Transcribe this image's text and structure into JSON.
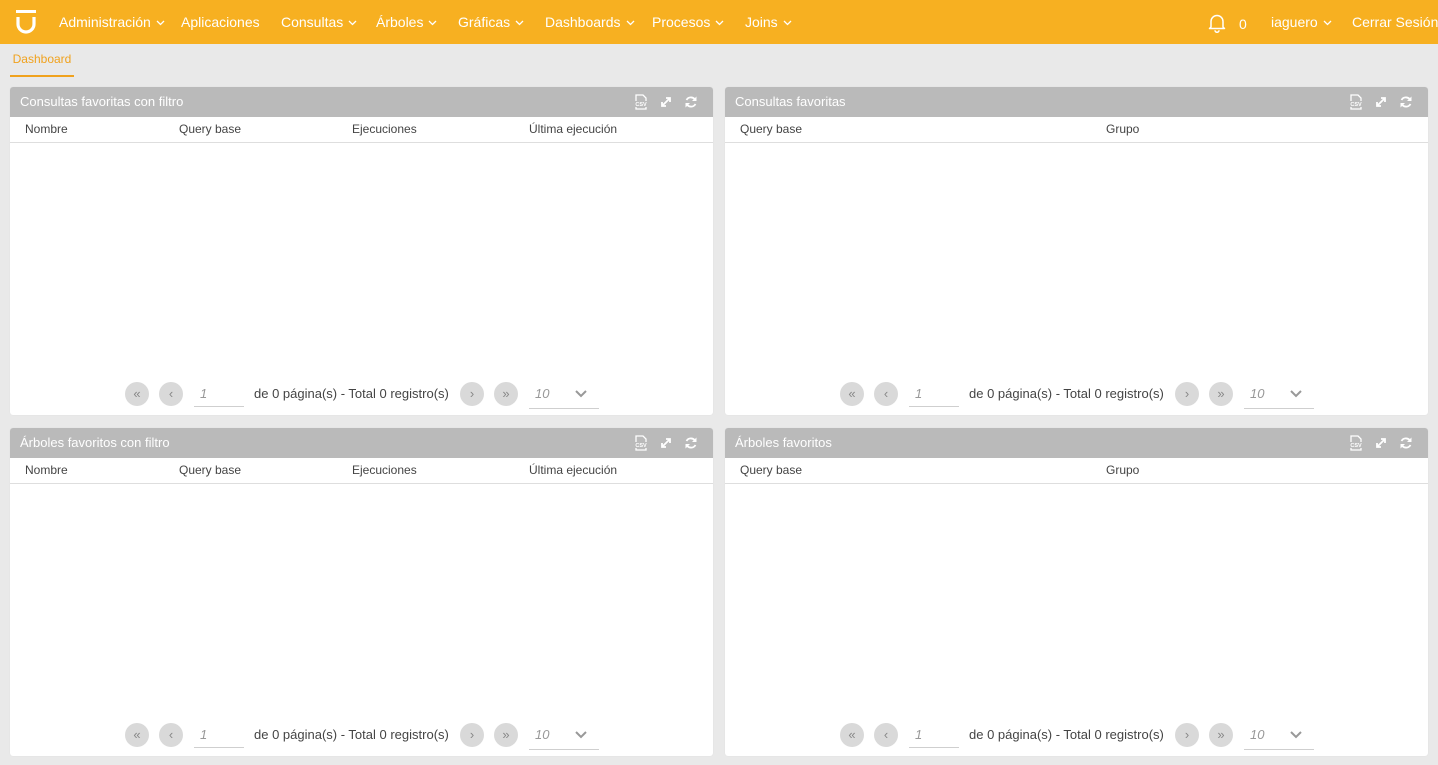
{
  "colors": {
    "accent": "#f7b021",
    "panel_header": "#bababa",
    "background": "#e9e9e9"
  },
  "navbar": {
    "items": [
      {
        "label": "Administración",
        "dropdown": true
      },
      {
        "label": "Aplicaciones",
        "dropdown": false
      },
      {
        "label": "Consultas",
        "dropdown": true
      },
      {
        "label": "Árboles",
        "dropdown": true
      },
      {
        "label": "Gráficas",
        "dropdown": true
      },
      {
        "label": "Dashboards",
        "dropdown": true
      },
      {
        "label": "Procesos",
        "dropdown": true
      },
      {
        "label": "Joins",
        "dropdown": true
      }
    ],
    "notifications_count": "0",
    "user": "iaguero",
    "logout": "Cerrar Sesión"
  },
  "tabs": [
    {
      "label": "Dashboard",
      "active": true
    }
  ],
  "panels": [
    {
      "title": "Consultas favoritas con filtro",
      "columns": [
        "Nombre",
        "Query base",
        "Ejecuciones",
        "Última ejecución"
      ],
      "rows": [],
      "pager": {
        "page": "1",
        "info": "de 0 página(s) - Total 0 registro(s)",
        "page_size": "10"
      }
    },
    {
      "title": "Consultas favoritas",
      "columns": [
        "Query base",
        "Grupo"
      ],
      "rows": [],
      "pager": {
        "page": "1",
        "info": "de 0 página(s) - Total 0 registro(s)",
        "page_size": "10"
      }
    },
    {
      "title": "Árboles favoritos con filtro",
      "columns": [
        "Nombre",
        "Query base",
        "Ejecuciones",
        "Última ejecución"
      ],
      "rows": [],
      "pager": {
        "page": "1",
        "info": "de 0 página(s) - Total 0 registro(s)",
        "page_size": "10"
      }
    },
    {
      "title": "Árboles favoritos",
      "columns": [
        "Query base",
        "Grupo"
      ],
      "rows": [],
      "pager": {
        "page": "1",
        "info": "de 0 página(s) - Total 0 registro(s)",
        "page_size": "10"
      }
    }
  ],
  "panel_icons": [
    "csv-export-icon",
    "expand-icon",
    "refresh-icon"
  ],
  "pager_icons": [
    "first-page-icon",
    "prev-page-icon",
    "next-page-icon",
    "last-page-icon"
  ]
}
